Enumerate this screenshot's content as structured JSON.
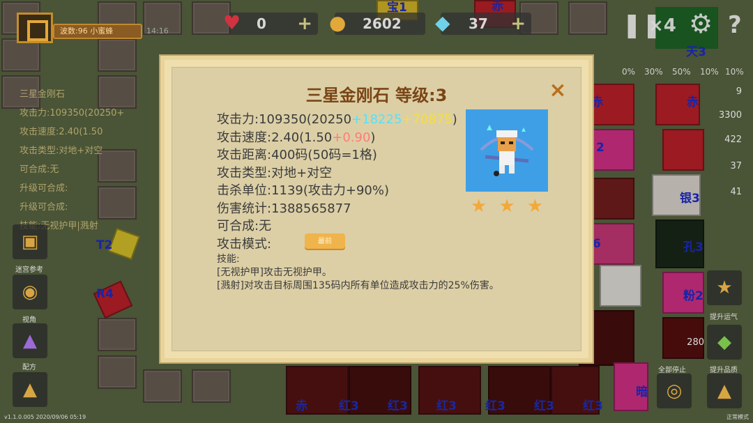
{
  "header": {
    "wave_text": "波数:96 小蜜蜂",
    "timer": "14:16",
    "hearts": "0",
    "coins": "2602",
    "gems": "37"
  },
  "icons": {
    "heart": "heart-icon",
    "coin": "coin-icon",
    "gem": "diamond-icon",
    "pause": "pause-icon",
    "speed": "speed-x4-icon",
    "settings": "gear-icon",
    "help": "question-icon"
  },
  "top_right": {
    "speed_label": "×4",
    "gem_odds": [
      "0%",
      "30%",
      "50%",
      "10%",
      "10%"
    ]
  },
  "right_stats": [
    "9",
    "3300",
    "422",
    "37",
    "41"
  ],
  "background_labels": [
    "宝1",
    "赤",
    "天3",
    "赤",
    "赤",
    "2",
    "银3",
    "孔3",
    "6",
    "粉2",
    "暗",
    "T2",
    "R4"
  ],
  "left_info": [
    "三星金刚石",
    "攻击力:109350(20250+",
    "攻击速度:2.40(1.50",
    "攻击类型:对地+对空",
    "可合成:无",
    "升级可合成:",
    "升级可合成:",
    "技能:无视护甲|溅射"
  ],
  "left_buttons": [
    "迷宫参考",
    "视角",
    "配方"
  ],
  "right_buttons": [
    "提升运气",
    "提升品质"
  ],
  "right_coins": "280",
  "stop_label": "全部停止",
  "bottom_labels": [
    "赤",
    "红3",
    "红3",
    "红3",
    "红3",
    "红3",
    "红3",
    "暗"
  ],
  "version": "v1.1.0.005 2020/09/06 05:19",
  "mode_text": "正常模式",
  "modal": {
    "title": "三星金刚石 等级:3",
    "close_label": "×",
    "attack_prefix": "攻击力:109350(20250",
    "attack_bonus1": "+18225",
    "attack_bonus2": "+70875",
    "attack_suffix": ")",
    "speed_prefix": "攻击速度:2.40(1.50",
    "speed_bonus": "+0.90",
    "speed_suffix": ")",
    "range": "攻击距离:400码(50码=1格)",
    "type": "攻击类型:对地+对空",
    "kills": "击杀单位:1139(攻击力+90%)",
    "damage": "伤害统计:1388565877",
    "combine": "可合成:无",
    "mode_label": "攻击模式:",
    "mode_button": "最前",
    "skills_title": "技能:",
    "skill_1": "[无视护甲]攻击无视护甲。",
    "skill_2": "[溅射]对攻击目标周围135码内所有单位造成攻击力的25%伤害。",
    "stars": 3,
    "star_icon": "star-icon"
  },
  "colors": {
    "bonus_cyan": "#52e3ff",
    "bonus_yellow": "#f5df3a",
    "bonus_red": "#ff7b7b",
    "title_brown": "#7a4516",
    "portrait_blue": "#3f9fe6"
  }
}
